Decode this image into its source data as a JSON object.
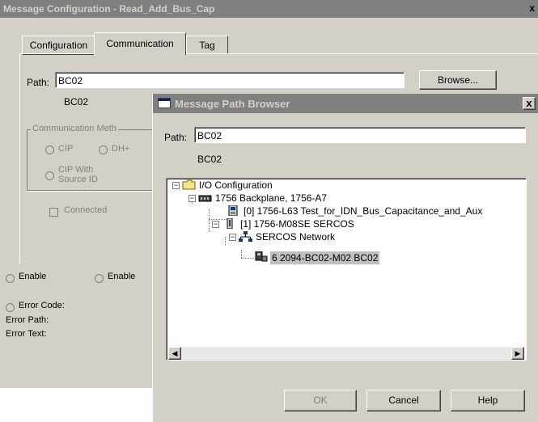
{
  "back_dialog": {
    "title": "Message Configuration - Read_Add_Bus_Cap",
    "close": "x",
    "tabs": [
      "Configuration",
      "Communication",
      "Tag"
    ],
    "path_label": "Path:",
    "path_value": "BC02",
    "path_resolved": "BC02",
    "browse_button": "Browse...",
    "comm_method_legend": "Communication Meth",
    "radio_cip": "CIP",
    "radio_dh": "DH+",
    "radio_cip_source_line1": "CIP With",
    "radio_cip_source_line2": "Source ID",
    "connected_label": "Connected",
    "enable_1": "Enable",
    "enable_2": "Enable",
    "error_code_label": "Error Code:",
    "error_path_label": "Error Path:",
    "error_text_label": "Error Text:"
  },
  "browser_dialog": {
    "title": "Message Path Browser",
    "close": "x",
    "path_label": "Path:",
    "path_value": "BC02",
    "path_resolved": "BC02",
    "tree": [
      {
        "label": "I/O Configuration",
        "icon": "folder-icon"
      },
      {
        "label": "1756 Backplane, 1756-A7",
        "icon": "backplane-icon"
      },
      {
        "label": "[0] 1756-L63 Test_for_IDN_Bus_Capacitance_and_Aux",
        "icon": "controller-icon"
      },
      {
        "label": "[1] 1756-M08SE SERCOS",
        "icon": "module-icon"
      },
      {
        "label": "SERCOS Network",
        "icon": "network-icon"
      },
      {
        "label": "6 2094-BC02-M02 BC02",
        "icon": "drive-icon",
        "selected": true
      }
    ],
    "ok_button": "OK",
    "cancel_button": "Cancel",
    "help_button": "Help"
  }
}
